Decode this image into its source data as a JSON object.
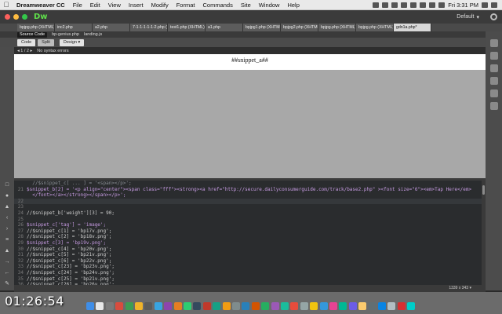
{
  "menubar": {
    "app_name": "Dreamweaver CC",
    "items": [
      "File",
      "Edit",
      "View",
      "Insert",
      "Modify",
      "Format",
      "Commands",
      "Site",
      "Window",
      "Help"
    ],
    "clock": "Fri 3:31 PM"
  },
  "app": {
    "logo": "Dw",
    "workspace": "Default",
    "workspace_caret": "▾"
  },
  "doc_tabs": [
    "bpjpg.php (XHTML)",
    "inc2.php",
    "a2.php",
    "7-1-1-1-1-1-2.php (XHTML)",
    "test1.php (XHTML)",
    "a1.php",
    "bpjpg1.php (XHTML)",
    "bpjpg2.php (XHTML)",
    "bpjpg.php (XHTML)",
    "bpjpg.php (XHTML)",
    "gdn1a.php*"
  ],
  "related_files": {
    "source": "Source Code",
    "files": [
      "bp-genius.php",
      "landing.js"
    ]
  },
  "view_buttons": {
    "code": "Code",
    "split": "Split",
    "design": "Design",
    "design_caret": "▾"
  },
  "status_bar": {
    "pager": "◂ 1 / 2 ▸",
    "message": "No syntax errors"
  },
  "design_view": {
    "placeholder": "##snippet_a##"
  },
  "code_lines": [
    {
      "n": "",
      "t": "  //$snippet_c[ ... ] = '<span></p>';",
      "k": "c"
    },
    {
      "n": "21",
      "t": "$snippet_b[2] = '<p align=\"center\"><span class=\"fff\"><strong><a href=\"http://secure.dailyconsumerguide.com/track/base2.php\" ><font size=\"6\"><em>Tap Here</em>",
      "k": "v"
    },
    {
      "n": "",
      "t": "  </font></a></strong></span></p>';",
      "k": "v"
    },
    {
      "n": "22",
      "t": "",
      "k": "",
      "cur": true
    },
    {
      "n": "23",
      "t": "",
      "k": ""
    },
    {
      "n": "24",
      "t": "//$snippet_b['weight'][3] = 90;",
      "k": "t"
    },
    {
      "n": "25",
      "t": "",
      "k": ""
    },
    {
      "n": "26",
      "t": "$snippet_c['tag'] = 'image';",
      "k": "v"
    },
    {
      "n": "27",
      "t": "//$snippet_c[1] = 'bp17v.png';",
      "k": "t"
    },
    {
      "n": "28",
      "t": "//$snippet_c[2] = 'bp18v.png';",
      "k": "t"
    },
    {
      "n": "29",
      "t": "$snippet_c[3] = 'bp19v.png';",
      "k": "v"
    },
    {
      "n": "30",
      "t": "//$snippet_c[4] = 'bp20v.png';",
      "k": "t"
    },
    {
      "n": "31",
      "t": "//$snippet_c[5] = 'bp21v.png';",
      "k": "t"
    },
    {
      "n": "32",
      "t": "//$snippet_c[6] = 'bp22v.png';",
      "k": "t"
    },
    {
      "n": "33",
      "t": "//$snippet_c[23] = 'bp23v.png';",
      "k": "t"
    },
    {
      "n": "34",
      "t": "//$snippet_c[24] = 'bp24v.png';",
      "k": "t"
    },
    {
      "n": "35",
      "t": "//$snippet_c[25] = 'bp21v.png';",
      "k": "t"
    },
    {
      "n": "36",
      "t": "//$snippet_c[26] = 'bp26v.png';",
      "k": "t"
    }
  ],
  "code_status": {
    "dims": "1339 x 343 ▾"
  },
  "overlay": {
    "timestamp": "01:26:54"
  },
  "colors": {
    "dw_green": "#5fe04a",
    "close": "#fc605c",
    "minimize": "#fdbc40",
    "zoom": "#34c84a"
  }
}
